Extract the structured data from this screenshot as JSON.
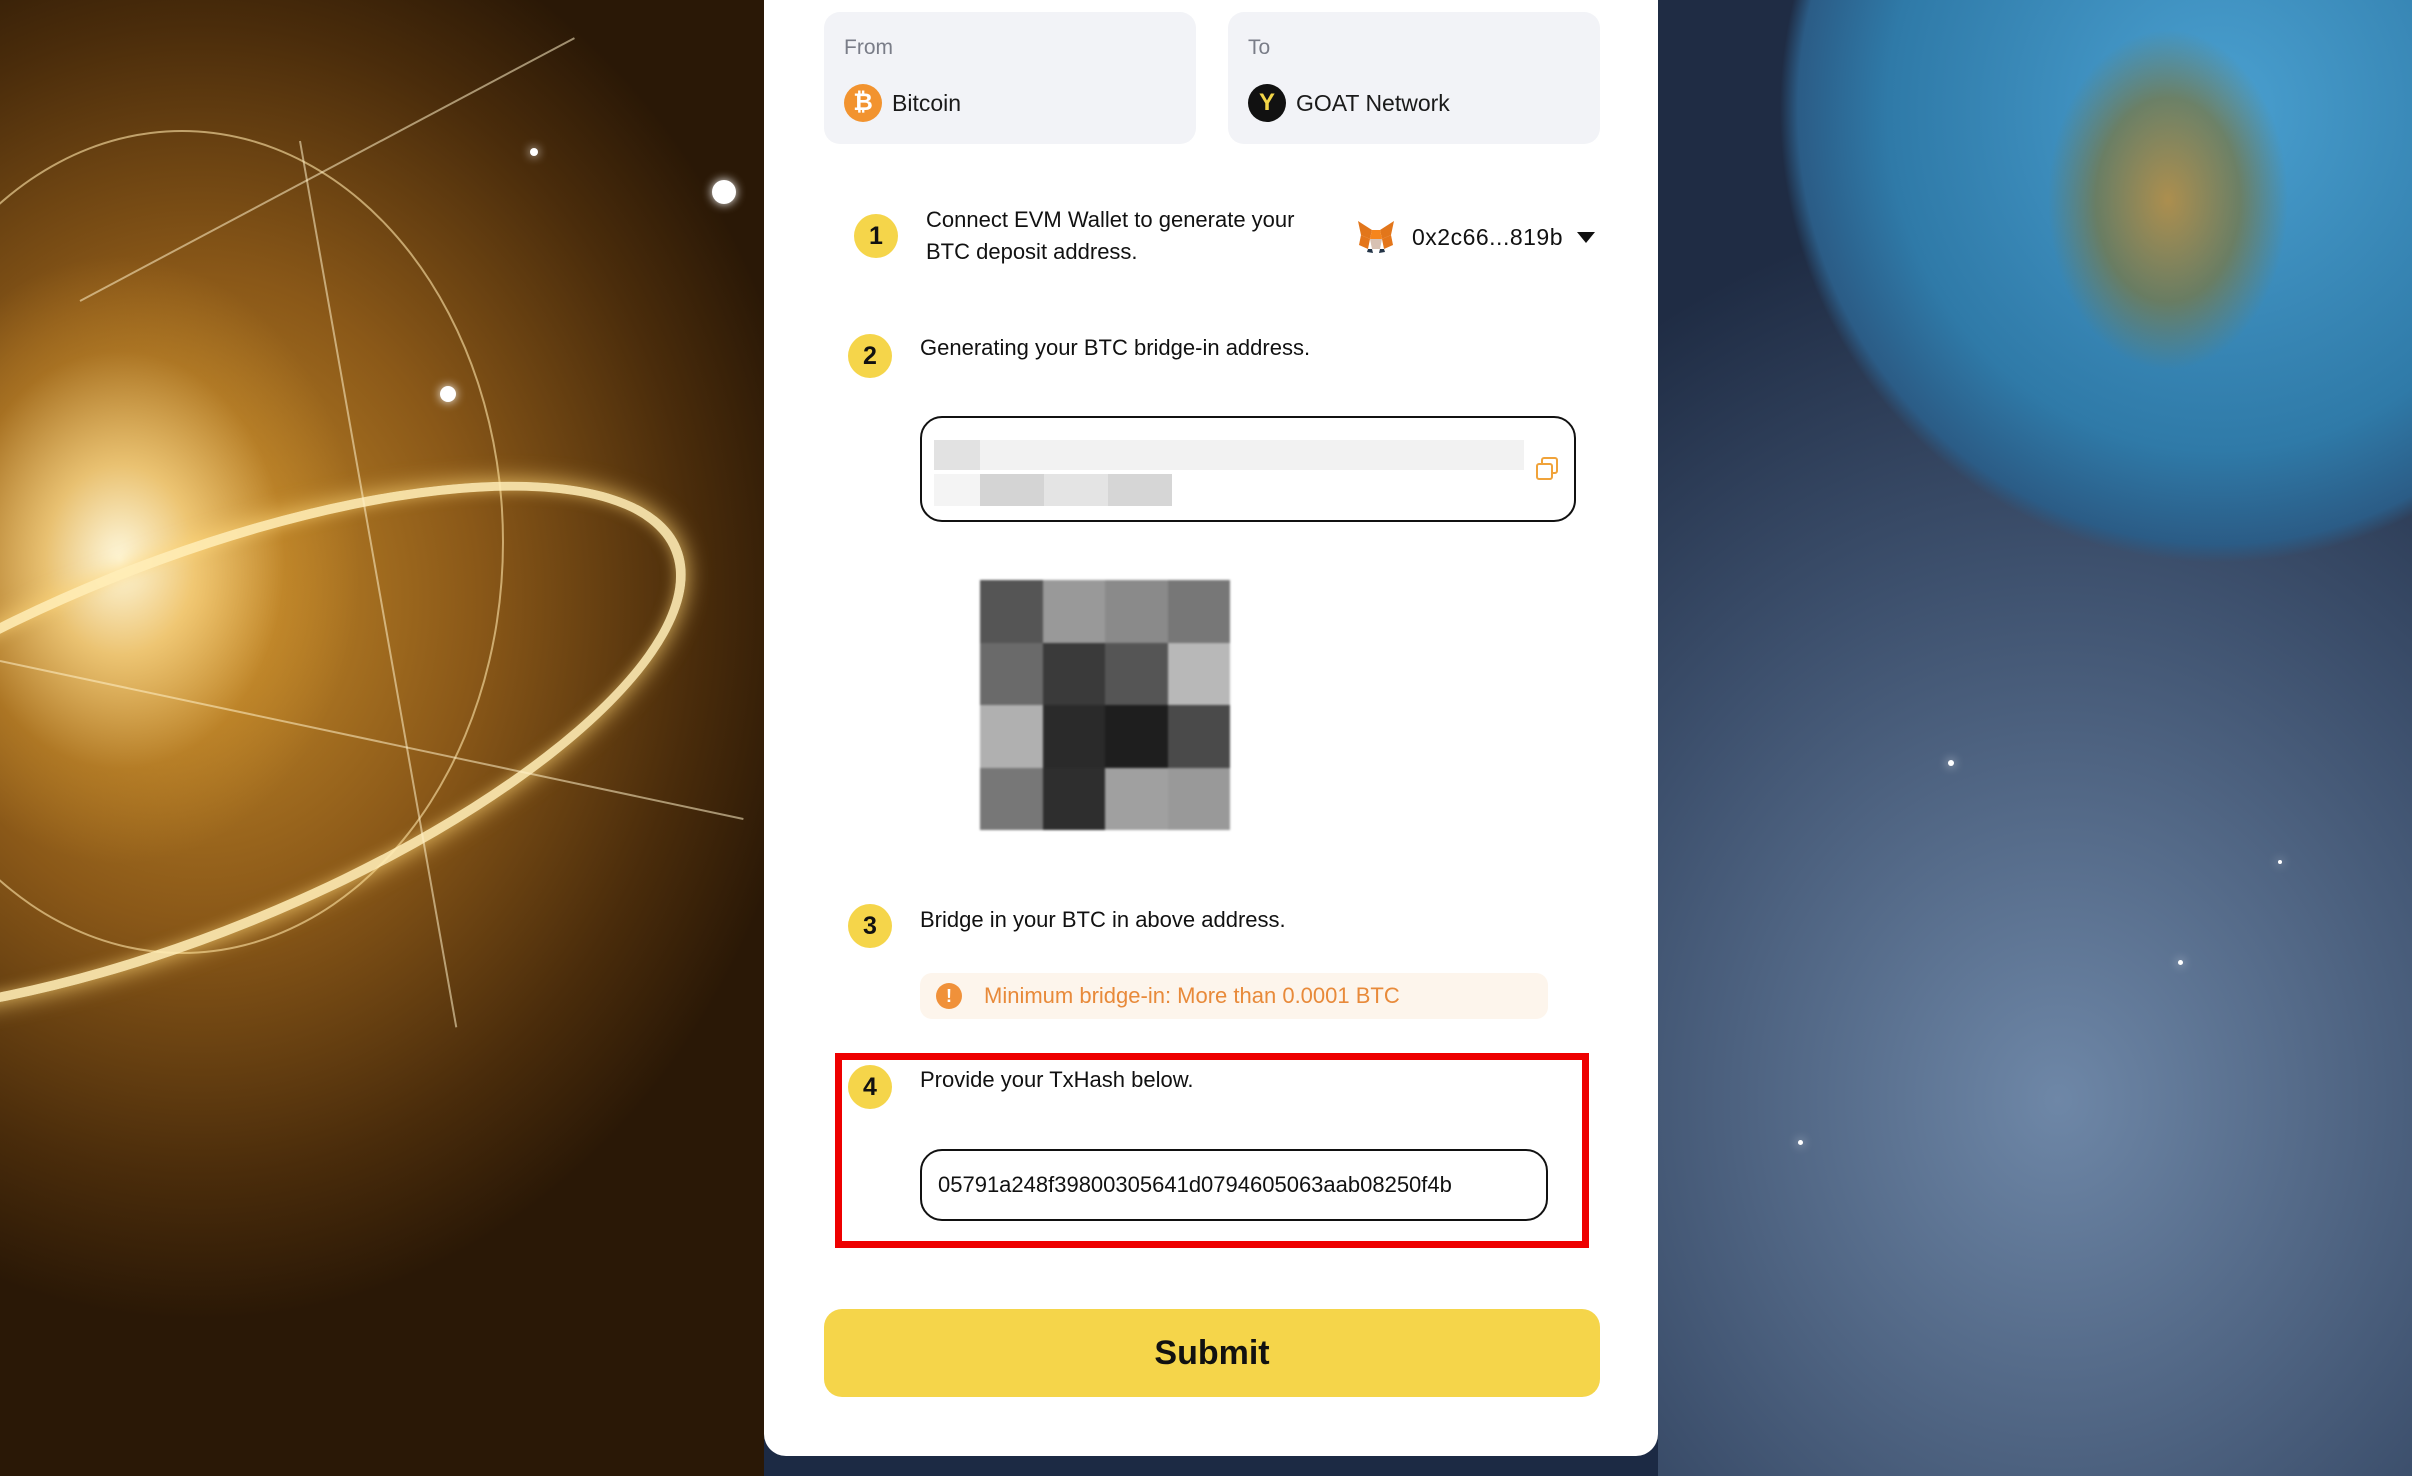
{
  "bridge": {
    "from": {
      "label": "From",
      "network": "Bitcoin",
      "icon": "bitcoin-icon"
    },
    "to": {
      "label": "To",
      "network": "GOAT Network",
      "icon": "goat-network-icon"
    }
  },
  "wallet": {
    "address": "0x2c66...819b",
    "icon": "metamask-fox-icon"
  },
  "steps": [
    {
      "num": "1",
      "text_line1": "Connect EVM Wallet to generate your",
      "text_line2": "BTC deposit address."
    },
    {
      "num": "2",
      "text": "Generating your BTC bridge-in address."
    },
    {
      "num": "3",
      "text": "Bridge in your BTC in above address.",
      "warning": "Minimum bridge-in: More than 0.0001 BTC"
    },
    {
      "num": "4",
      "text": "Provide your TxHash below.",
      "txhash": "05791a248f39800305641d0794605063aab08250f4b"
    }
  ],
  "submit_label": "Submit",
  "colors": {
    "accent": "#f5d54a",
    "warning": "#e88a3a",
    "highlight": "#ee0000"
  }
}
